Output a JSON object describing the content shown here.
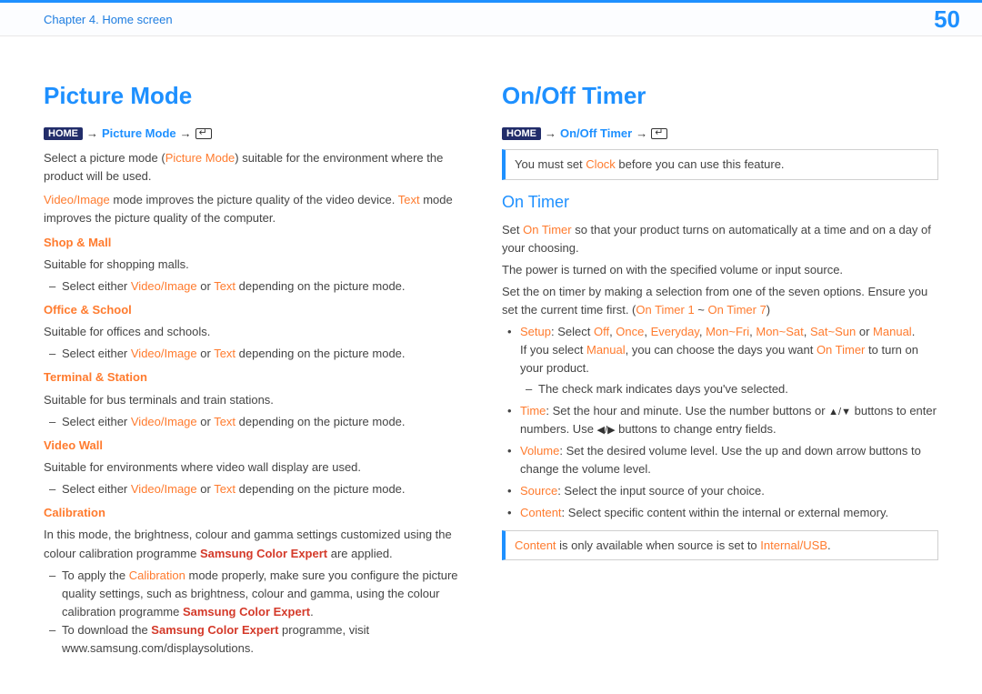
{
  "page": {
    "breadcrumb": "Chapter 4. Home screen",
    "number": "50"
  },
  "nav": {
    "home_badge": "HOME",
    "arrow": "→"
  },
  "left": {
    "title": "Picture Mode",
    "nav_highlight": "Picture Mode",
    "intro1_a": "Select a picture mode (",
    "intro1_accent": "Picture Mode",
    "intro1_b": ") suitable for the environment where the product will be used.",
    "intro2_a": "Video/Image",
    "intro2_b": " mode improves the picture quality of the video device. ",
    "intro2_c": "Text",
    "intro2_d": " mode improves the picture quality of the computer.",
    "groups": {
      "shopmall": {
        "label": "Shop & Mall",
        "desc": "Suitable for shopping malls.",
        "bullet_a": "Select either ",
        "bullet_vi": "Video/Image",
        "bullet_or": " or ",
        "bullet_text": "Text",
        "bullet_b": " depending on the picture mode."
      },
      "office": {
        "label": "Office & School",
        "desc": "Suitable for offices and schools.",
        "bullet_a": "Select either ",
        "bullet_vi": "Video/Image",
        "bullet_or": " or ",
        "bullet_text": "Text",
        "bullet_b": " depending on the picture mode."
      },
      "terminal": {
        "label": "Terminal & Station",
        "desc": "Suitable for bus terminals and train stations.",
        "bullet_a": "Select either ",
        "bullet_vi": "Video/Image",
        "bullet_or": " or ",
        "bullet_text": "Text",
        "bullet_b": " depending on the picture mode."
      },
      "videowall": {
        "label": "Video Wall",
        "desc": "Suitable for environments where video wall display are used.",
        "bullet_a": "Select either ",
        "bullet_vi": "Video/Image",
        "bullet_or": " or ",
        "bullet_text": "Text",
        "bullet_b": " depending on the picture mode."
      },
      "calibration": {
        "label": "Calibration",
        "desc_a": "In this mode, the brightness, colour and gamma settings customized using the colour calibration programme ",
        "desc_brand": "Samsung Color Expert",
        "desc_b": " are applied.",
        "d1_a": "To apply the ",
        "d1_accent": "Calibration",
        "d1_b": " mode properly, make sure you configure the picture quality settings, such as brightness, colour and gamma, using the colour calibration programme ",
        "d1_brand": "Samsung Color Expert",
        "d1_c": ".",
        "d2_a": "To download the ",
        "d2_brand": "Samsung Color Expert",
        "d2_b": " programme, visit www.samsung.com/displaysolutions."
      }
    }
  },
  "right": {
    "title": "On/Off Timer",
    "nav_highlight": "On/Off Timer",
    "callout1_a": "You must set ",
    "callout1_accent": "Clock",
    "callout1_b": " before you can use this feature.",
    "sub_title": "On Timer",
    "p1_a": "Set ",
    "p1_accent": "On Timer",
    "p1_b": " so that your product turns on automatically at a time and on a day of your choosing.",
    "p2": "The power is turned on with the specified volume or input source.",
    "p3_a": "Set the on timer by making a selection from one of the seven options. Ensure you set the current time first. (",
    "p3_ot1": "On Timer 1",
    "p3_tilde": " ~ ",
    "p3_ot7": "On Timer 7",
    "p3_close": ")",
    "setup": {
      "label": "Setup",
      "a": ": Select ",
      "off": "Off",
      "c1": ", ",
      "once": "Once",
      "everyday": "Everyday",
      "monfri": "Mon~Fri",
      "monsat": "Mon~Sat",
      "satsun": "Sat~Sun",
      "or": " or ",
      "manual": "Manual",
      "dot": ".",
      "b_a": "If you select ",
      "b_manual": "Manual",
      "b_b": ", you can choose the days you want ",
      "b_ot": "On Timer",
      "b_c": " to turn on your product.",
      "dash1": "The check mark indicates days you've selected."
    },
    "time": {
      "label": "Time",
      "txt_a": ": Set the hour and minute. Use the number buttons or ",
      "ud": "▲/▼",
      "txt_b": " buttons to enter numbers. Use ",
      "lr": "◀/▶",
      "txt_c": " buttons to change entry fields."
    },
    "volume": {
      "label": "Volume",
      "txt": ": Set the desired volume level. Use the up and down arrow buttons to change the volume level."
    },
    "source": {
      "label": "Source",
      "txt": ": Select the input source of your choice."
    },
    "content": {
      "label": "Content",
      "txt": ": Select specific content within the internal or external memory."
    },
    "callout2_a": "Content",
    "callout2_b": " is only available when source is set to ",
    "callout2_c": "Internal/USB",
    "callout2_d": "."
  }
}
